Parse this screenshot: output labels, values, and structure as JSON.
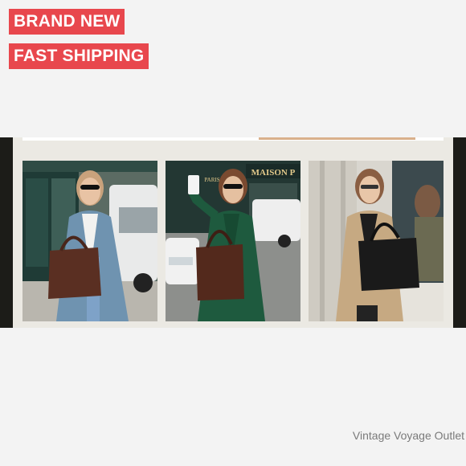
{
  "badges": {
    "condition": "BRAND NEW",
    "shipping": "FAST SHIPPING"
  },
  "colors": {
    "badge_background": "#e8474d",
    "badge_text": "#ffffff",
    "page_background": "#f3f3f3",
    "banner_background": "#ebe9e3",
    "shop_text": "#7a7a7a"
  },
  "banner": {
    "photos": [
      {
        "subject": "woman in blue trench coat holding brown leather tote on street",
        "icon": "product-lifestyle-photo"
      },
      {
        "subject": "woman in green trench coat taking selfie holding brown leather tote",
        "icon": "product-lifestyle-photo"
      },
      {
        "subject": "woman in beige trench coat holding black leather tote",
        "icon": "product-lifestyle-photo"
      }
    ],
    "storefront_sign": "MAISON P",
    "storefront_sign_small": "PARIS"
  },
  "shop": {
    "name": "Vintage Voyage Outlet"
  }
}
